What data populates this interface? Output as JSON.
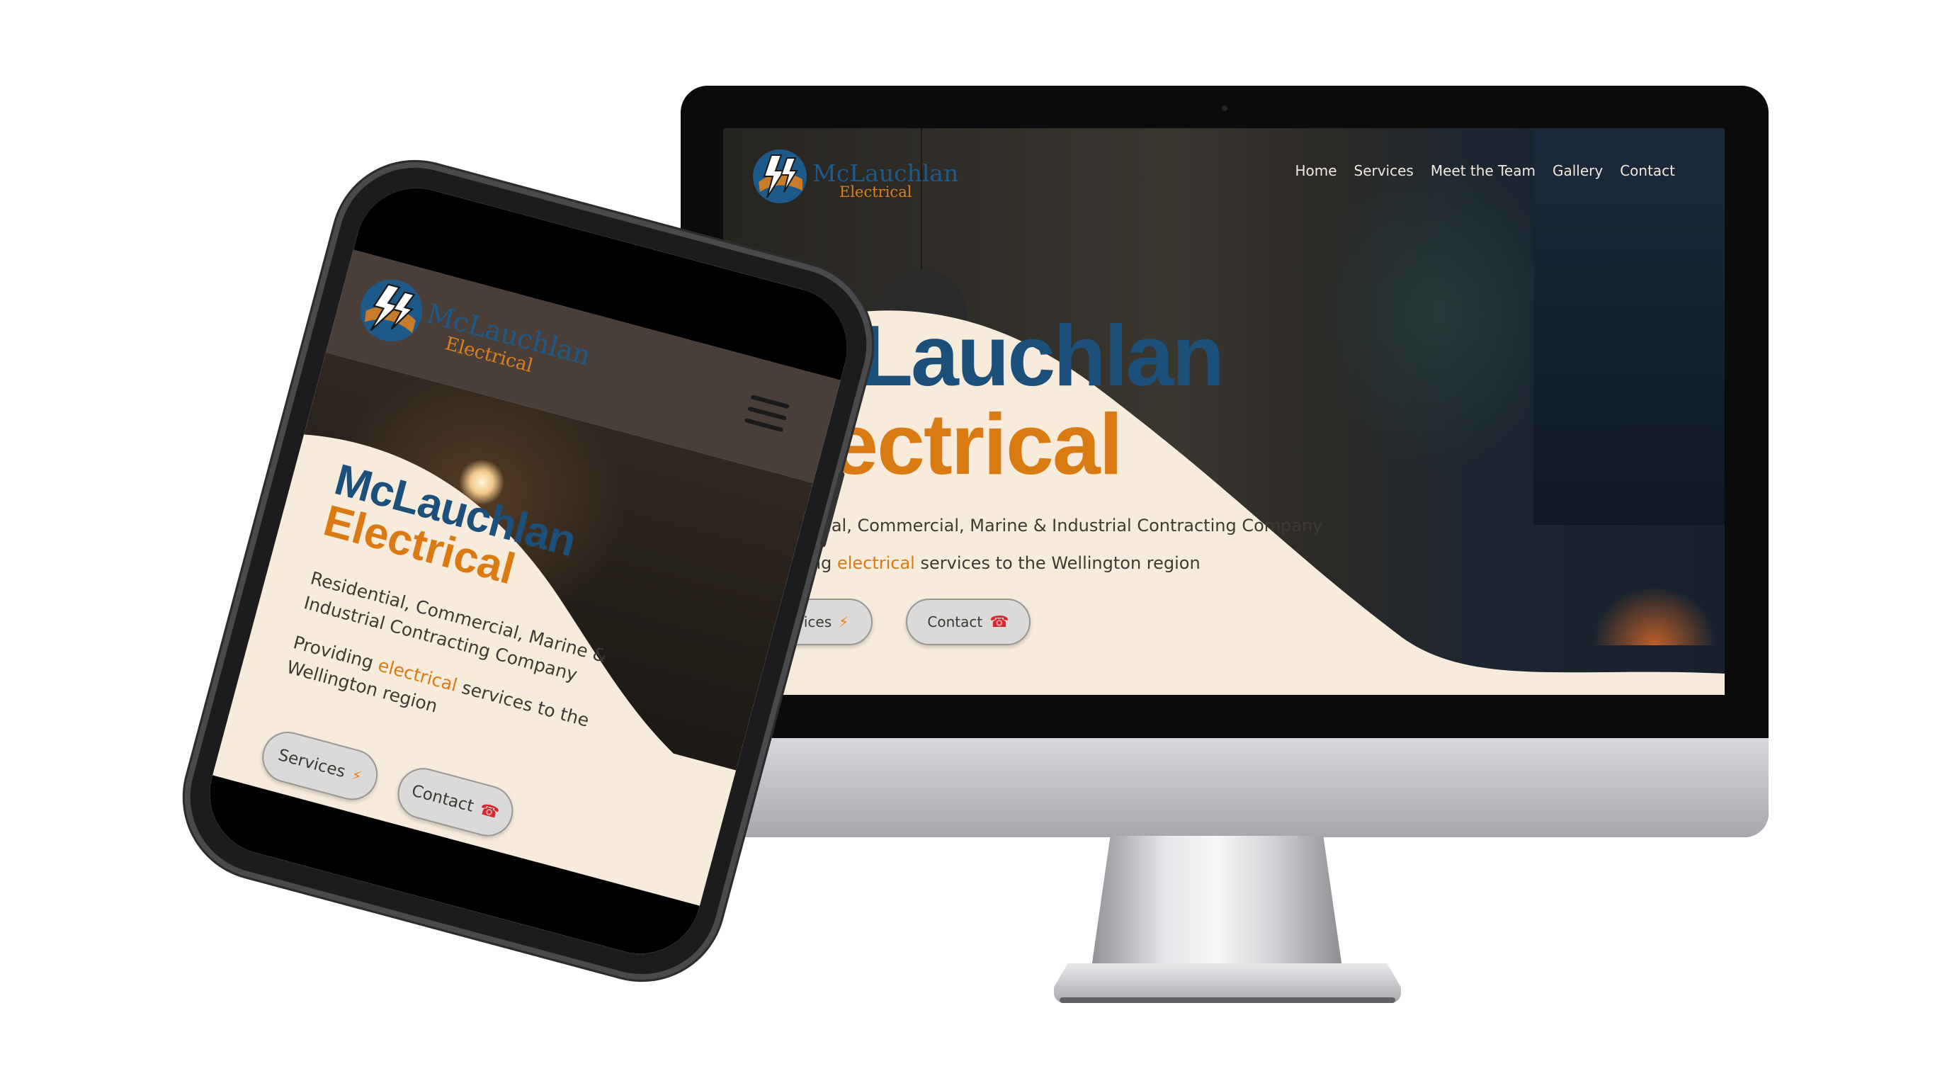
{
  "brand": {
    "name_line1": "McLauchlan",
    "name_line2": "Electrical",
    "colors": {
      "blue": "#1c4f7a",
      "orange": "#d97a12",
      "cream": "#f7ecdb"
    }
  },
  "desktop": {
    "nav": [
      "Home",
      "Services",
      "Meet the Team",
      "Gallery",
      "Contact"
    ],
    "hero": {
      "title_line1": "McLauchlan",
      "title_line2": "Electrical",
      "subtitle": "Residential, Commercial, Marine & Industrial Contracting Company",
      "tagline_pre": "Providing ",
      "tagline_highlight": "electrical",
      "tagline_post": " services to the Wellington region"
    },
    "buttons": {
      "services_label": "Services",
      "services_icon": "lightning-bolt-icon",
      "contact_label": "Contact",
      "contact_icon": "phone-icon"
    }
  },
  "mobile": {
    "hero": {
      "title_line1": "McLauchlan",
      "title_line2": "Electrical",
      "subtitle_line1": "Residential, Commercial, Marine &",
      "subtitle_line2": "Industrial Contracting Company",
      "tagline_line1_pre": "Providing ",
      "tagline_highlight": "electrical",
      "tagline_line1_post": " services to the",
      "tagline_line2": "Wellington region"
    },
    "menu_icon": "hamburger-menu-icon",
    "buttons": {
      "services_label": "Services",
      "contact_label": "Contact"
    }
  }
}
